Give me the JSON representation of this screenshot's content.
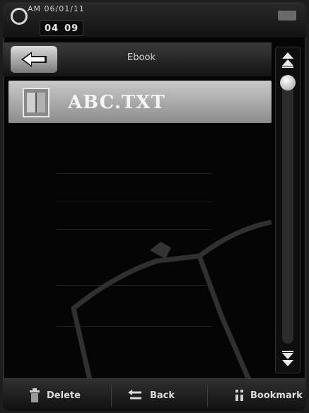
{
  "status": {
    "top_text": "AM 06/01/11",
    "date_parts": [
      "04",
      "09"
    ]
  },
  "header": {
    "title": "Ebook"
  },
  "files": [
    {
      "name": "ABC.TXT"
    }
  ],
  "scroll": {
    "position": 0
  },
  "toolbar": {
    "delete_label": "Delete",
    "back_label": "Back",
    "bookmark_label": "Bookmark"
  },
  "colors": {
    "background": "#050505",
    "selected_row": "#b4b4b4",
    "text": "#e6e6e6"
  },
  "icons": {
    "back": "arrow-left-icon",
    "file": "document-icon",
    "scroll_up": "double-chevron-up-icon",
    "scroll_down": "double-chevron-down-icon",
    "delete": "trash-icon",
    "return": "return-icon",
    "bookmark": "bookmark-icon"
  }
}
